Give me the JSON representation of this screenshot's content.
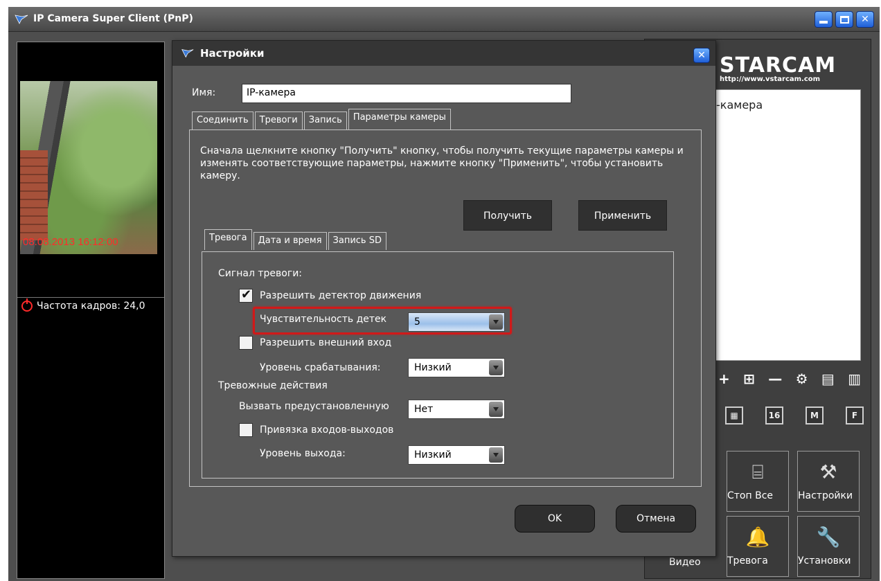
{
  "app": {
    "title": "IP Camera Super Client (PnP)",
    "accent_color": "#2f6fe0",
    "window_buttons": [
      "minimize-icon",
      "maximize-icon",
      "close-icon"
    ]
  },
  "video": {
    "timestamp": "08.08.2013 16:12:00",
    "fps_label": "Частота кадров: 24,0"
  },
  "right_panel": {
    "logo_text": "STARCAM",
    "logo_url_text": "http://www.vstarcam.com",
    "camera_list": [
      "-камера"
    ],
    "toolbar_icons": [
      "add-icon",
      "device-icon",
      "remove-icon",
      "gear-icon",
      "export-icon",
      "import-icon"
    ],
    "view_buttons": [
      "",
      "16",
      "M",
      "F"
    ],
    "big_buttons": [
      {
        "label": "Стоп Все",
        "icon": "stop-all-icon"
      },
      {
        "label": "Настройки",
        "icon": "settings-icon"
      },
      {
        "label": "Видео",
        "icon": "video-icon"
      },
      {
        "label": "Тревога",
        "icon": "bell-icon"
      },
      {
        "label": "Установки",
        "icon": "wrench-icon"
      }
    ]
  },
  "dialog": {
    "title": "Настройки",
    "name_label": "Имя:",
    "name_value": "IP-камера",
    "tabs": [
      "Соединить",
      "Тревоги",
      "Запись",
      "Параметры камеры"
    ],
    "active_tab": "Параметры камеры",
    "description": "Сначала щелкните кнопку \"Получить\" кнопку, чтобы получить текущие параметры камеры и изменять соответствующие параметры, нажмите кнопку \"Применить\", чтобы установить камеру.",
    "get_button": "Получить",
    "apply_button": "Применить",
    "inner_tabs": [
      "Тревога",
      "Дата и время",
      "Запись SD"
    ],
    "active_inner_tab": "Тревога",
    "alarm_signal_heading": "Сигнал тревоги:",
    "motion_checkbox_label": "Разрешить детектор движения",
    "motion_checked": true,
    "sensitivity_label": "Чувствительность детек",
    "sensitivity_value": "5",
    "external_input_label": "Разрешить внешний вход",
    "external_input_checked": false,
    "trigger_level_label": "Уровень срабатывания:",
    "trigger_level_value": "Низкий",
    "alarm_actions_heading": "Тревожные действия",
    "preset_label": "Вызвать предустановленную",
    "preset_value": "Нет",
    "io_binding_label": "Привязка входов-выходов",
    "io_binding_checked": false,
    "output_level_label": "Уровень выхода:",
    "output_level_value": "Низкий",
    "ok_button": "OK",
    "cancel_button": "Отмена"
  }
}
